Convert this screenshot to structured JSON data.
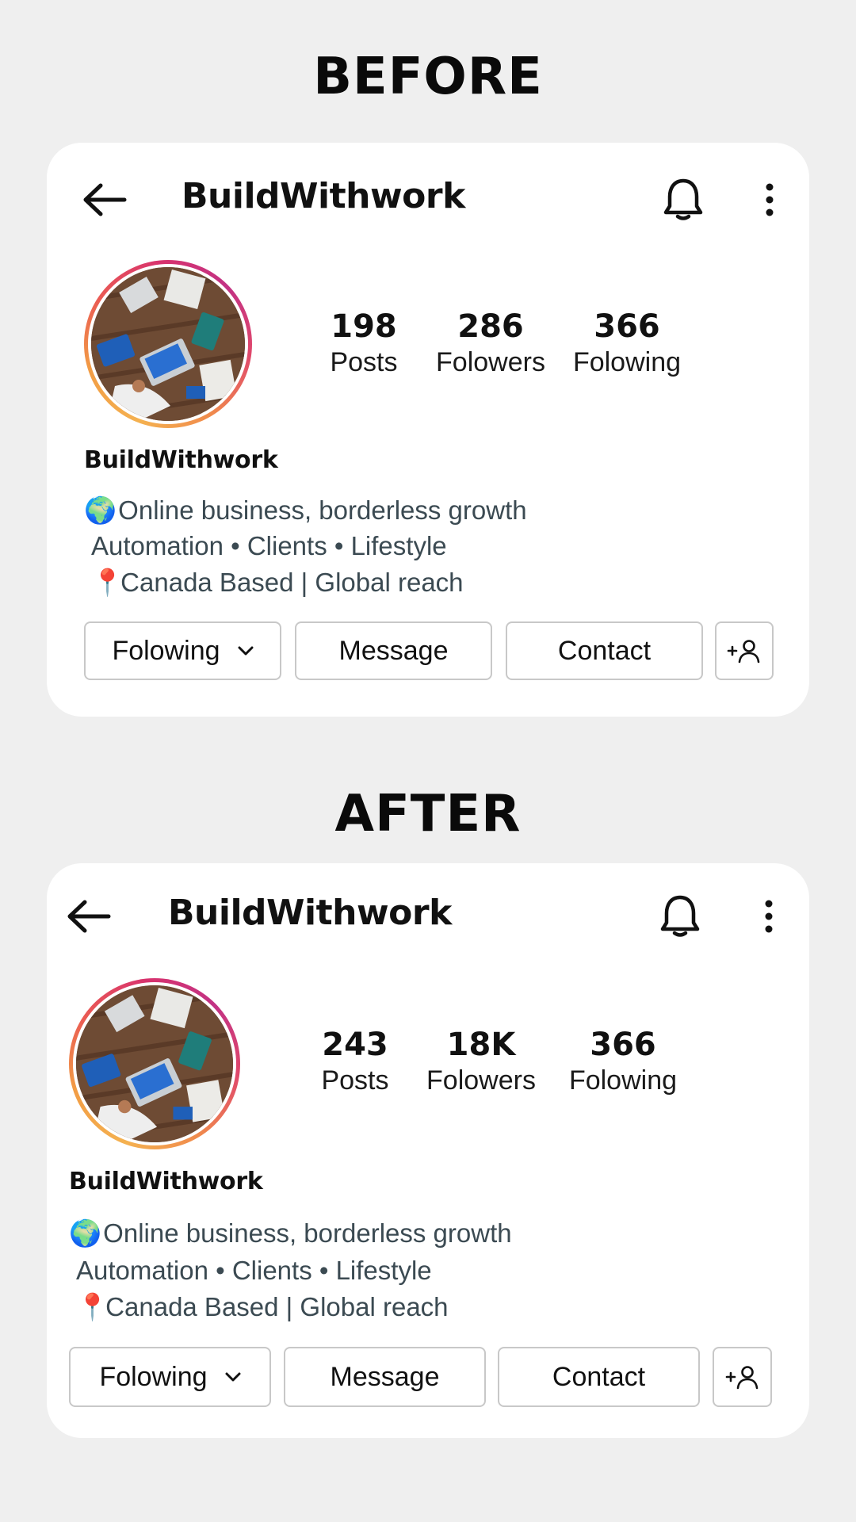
{
  "before": {
    "heading": "BEFORE",
    "profile": {
      "title": "BuildWithwork",
      "display_name": "BuildWithwork",
      "stats": [
        {
          "value": "198",
          "label": "Posts"
        },
        {
          "value": "286",
          "label": "Folowers"
        },
        {
          "value": "366",
          "label": "Folowing"
        }
      ],
      "bio": [
        {
          "emoji": "🌍",
          "text": "Online business, borderless growth"
        },
        {
          "emoji": "",
          "text": "Automation • Clients • Lifestyle"
        },
        {
          "emoji": "📍",
          "text": "Canada Based | Global reach"
        }
      ],
      "buttons": {
        "following": "Folowing",
        "message": "Message",
        "contact": "Contact",
        "add_user": "+👤"
      }
    }
  },
  "after": {
    "heading": "AFTER",
    "profile": {
      "title": "BuildWithwork",
      "display_name": "BuildWithwork",
      "stats": [
        {
          "value": "243",
          "label": "Posts"
        },
        {
          "value": "18K",
          "label": "Folowers"
        },
        {
          "value": "366",
          "label": "Folowing"
        }
      ],
      "bio": [
        {
          "emoji": "🌍",
          "text": "Online business, borderless growth"
        },
        {
          "emoji": "",
          "text": "Automation • Clients • Lifestyle"
        },
        {
          "emoji": "📍",
          "text": "Canada Based | Global reach"
        }
      ],
      "buttons": {
        "following": "Folowing",
        "message": "Message",
        "contact": "Contact",
        "add_user": "+👤"
      }
    }
  },
  "icons": {
    "back": "arrow-left-icon",
    "bell": "bell-icon",
    "more": "more-vertical-icon",
    "chevron": "chevron-down-icon",
    "add_user": "add-user-icon"
  },
  "colors": {
    "page_bg": "#efefef",
    "card_bg": "#ffffff",
    "bio_text": "#3b4a52",
    "ring_orange": "#f4b150",
    "ring_pink": "#d8326d"
  }
}
